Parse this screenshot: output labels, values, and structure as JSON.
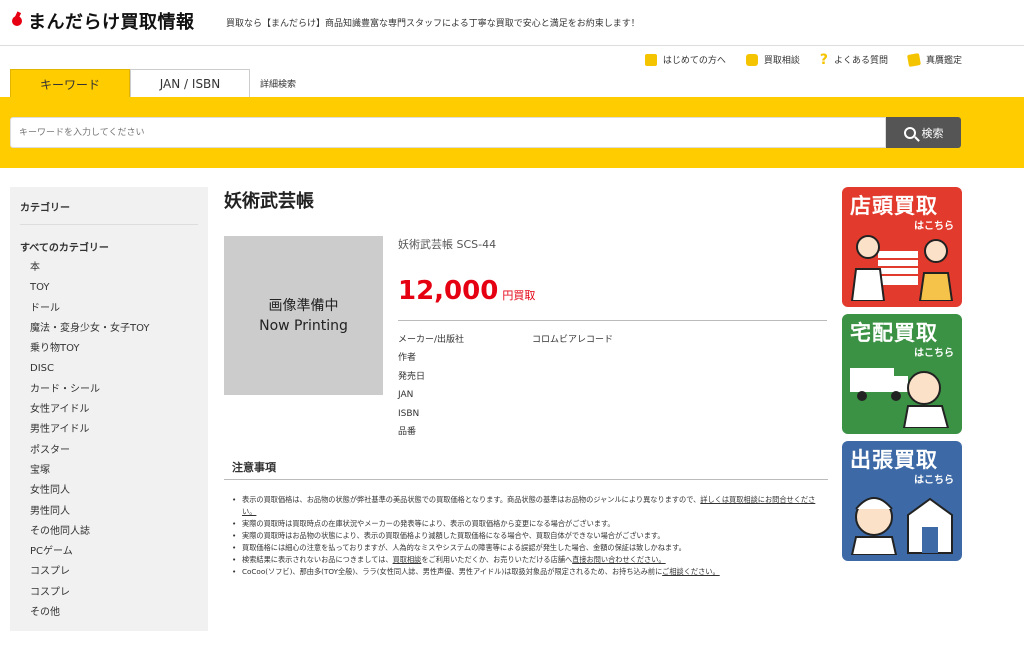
{
  "header": {
    "logo": "まんだらけ買取情報",
    "tagline": "買取なら【まんだらけ】商品知識豊富な専門スタッフによる丁寧な買取で安心と満足をお約束します！"
  },
  "util_links": [
    {
      "label": "はじめての方へ",
      "icon": "book-icon"
    },
    {
      "label": "買取相談",
      "icon": "chat-icon"
    },
    {
      "label": "よくある質問",
      "icon": "question-icon"
    },
    {
      "label": "真贋鑑定",
      "icon": "certificate-icon"
    }
  ],
  "tabs": {
    "keyword": "キーワード",
    "jan": "JAN / ISBN",
    "advanced": "詳細検索"
  },
  "search": {
    "placeholder": "キーワードを入力してください",
    "button": "検索"
  },
  "sidebar": {
    "heading": "カテゴリー",
    "all": "すべてのカテゴリー",
    "items": [
      "本",
      "TOY",
      "ドール",
      "魔法・変身少女・女子TOY",
      "乗り物TOY",
      "DISC",
      "カード・シール",
      "女性アイドル",
      "男性アイドル",
      "ポスター",
      "宝塚",
      "女性同人",
      "男性同人",
      "その他同人誌",
      "PCゲーム",
      "コスプレ",
      "コスプレ",
      "その他"
    ]
  },
  "product": {
    "title": "妖術武芸帳",
    "image_line1": "画像準備中",
    "image_line2": "Now Printing",
    "name": "妖術武芸帳 SCS-44",
    "price": "12,000",
    "price_unit": "円買取",
    "specs": [
      {
        "key": "メーカー/出版社",
        "value": "コロムビアレコード"
      },
      {
        "key": "作者",
        "value": ""
      },
      {
        "key": "発売日",
        "value": ""
      },
      {
        "key": "JAN",
        "value": ""
      },
      {
        "key": "ISBN",
        "value": ""
      },
      {
        "key": "品番",
        "value": ""
      }
    ]
  },
  "notes": {
    "title": "注意事項",
    "n1_pre": "表示の買取価格は、お品物の状態が弊社基準の美品状態での買取価格となります。商品状態の基準はお品物のジャンルにより異なりますので、",
    "n1_link": "詳しくは買取相談にお問合せください。",
    "n2": "実際の買取時は買取時点の在庫状況やメーカーの発表等により、表示の買取価格から変更になる場合がございます。",
    "n3": "実際の買取時はお品物の状態により、表示の買取価格より減額した買取価格になる場合や、買取自体ができない場合がございます。",
    "n4": "買取価格には細心の注意を払っておりますが、人為的なミスやシステムの障害等による誤認が発生した場合、金額の保証は致しかねます。",
    "n5_pre": "検索結果に表示されないお品につきましては、",
    "n5_link1": "買取相談",
    "n5_mid": "をご利用いただくか、お売りいただける店舗へ",
    "n5_link2": "直接お問い合わせください。",
    "n6_pre": "CoCoo(ソフビ)、那由多(TOY全般)、ララ(女性同人誌、男性声優、男性アイドル)は取扱対象品が限定されるため、お持ち込み前に",
    "n6_link": "ご相談ください。"
  },
  "banners": [
    {
      "title": "店頭買取",
      "sub": "はこちら",
      "color": "#e23a2c"
    },
    {
      "title": "宅配買取",
      "sub": "はこちら",
      "color": "#3b9144"
    },
    {
      "title": "出張買取",
      "sub": "はこちら",
      "color": "#3d6aa6"
    }
  ],
  "colors": {
    "accent": "#ffcc00",
    "price": "#e50012"
  }
}
